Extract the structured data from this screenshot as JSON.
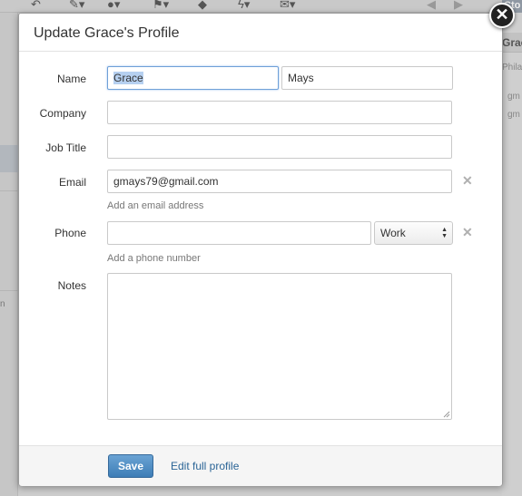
{
  "modal": {
    "title": "Update Grace's Profile",
    "close_glyph": "✕"
  },
  "form": {
    "name": {
      "label": "Name",
      "first_value": "Grace",
      "last_value": "Mays"
    },
    "company": {
      "label": "Company",
      "value": ""
    },
    "job_title": {
      "label": "Job Title",
      "value": ""
    },
    "email": {
      "label": "Email",
      "value": "gmays79@gmail.com",
      "add_link": "Add an email address",
      "remove_glyph": "✕"
    },
    "phone": {
      "label": "Phone",
      "value": "",
      "type_selected": "Work",
      "add_link": "Add a phone number",
      "remove_glyph": "✕"
    },
    "notes": {
      "label": "Notes",
      "value": ""
    }
  },
  "footer": {
    "save_label": "Save",
    "edit_full_label": "Edit full profile"
  },
  "background": {
    "right_panel_title": "Grace",
    "right_tab_text": "Cto",
    "right_location": "Philad",
    "right_item_1": "gm",
    "right_item_2": "gm",
    "sidebar_fragment": "n"
  },
  "colors": {
    "save_button": "#4a8bc3",
    "link": "#2a6496",
    "focus_border": "#6fa0d8"
  }
}
